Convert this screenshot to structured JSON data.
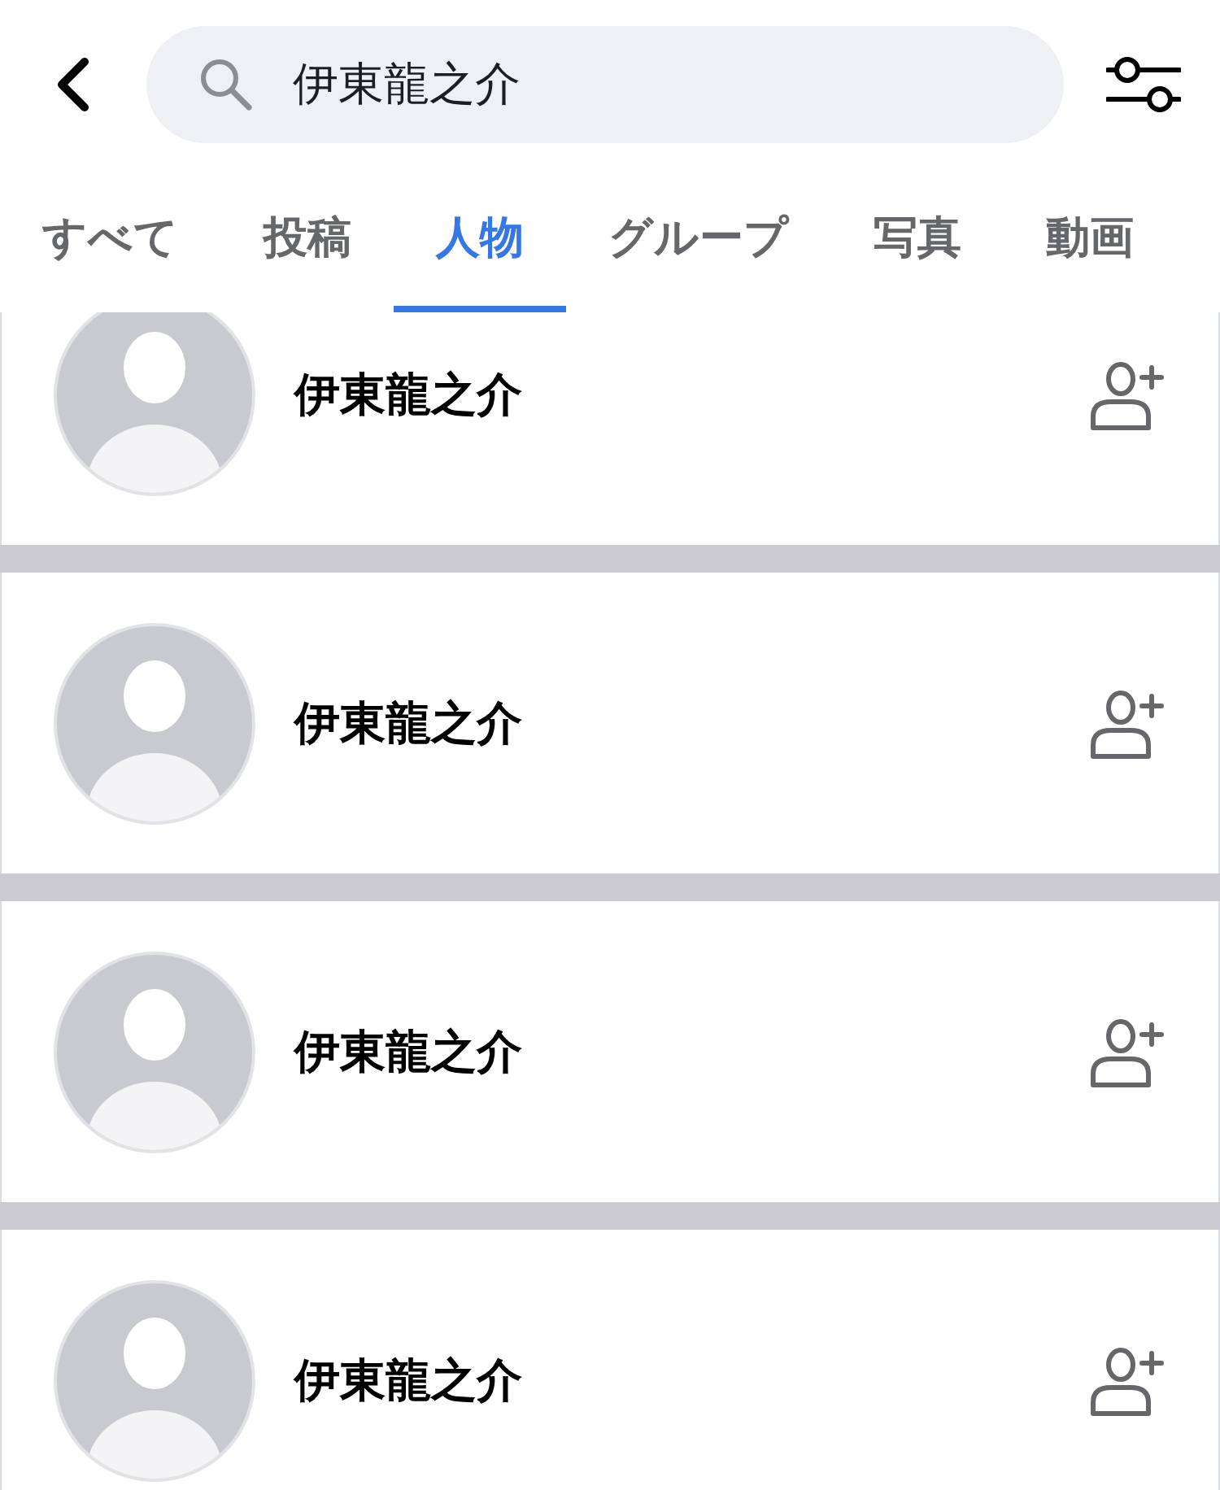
{
  "search": {
    "value": "伊東龍之介"
  },
  "tabs": [
    {
      "label": "すべて",
      "selected": false
    },
    {
      "label": "投稿",
      "selected": false
    },
    {
      "label": "人物",
      "selected": true
    },
    {
      "label": "グループ",
      "selected": false
    },
    {
      "label": "写真",
      "selected": false
    },
    {
      "label": "動画",
      "selected": false
    }
  ],
  "results": [
    {
      "name": "伊東龍之介"
    },
    {
      "name": "伊東龍之介"
    },
    {
      "name": "伊東龍之介"
    },
    {
      "name": "伊東龍之介"
    }
  ]
}
